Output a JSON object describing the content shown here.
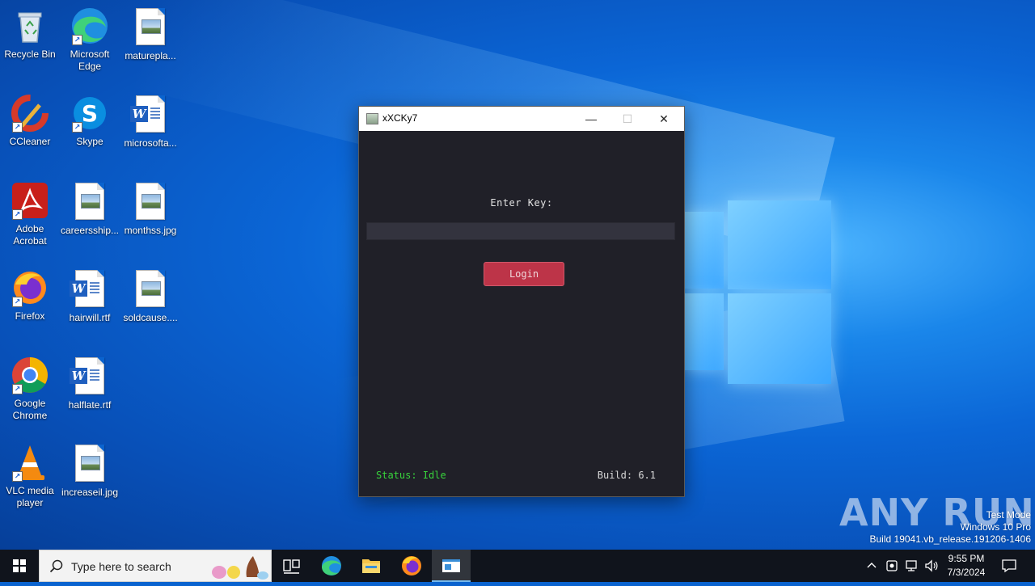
{
  "desktop": {
    "icons": [
      {
        "label": "Recycle Bin"
      },
      {
        "label": "Microsoft Edge"
      },
      {
        "label": "maturepla..."
      },
      {
        "label": "CCleaner"
      },
      {
        "label": "Skype"
      },
      {
        "label": "microsofta..."
      },
      {
        "label": "Adobe Acrobat"
      },
      {
        "label": "careersship..."
      },
      {
        "label": "monthss.jpg"
      },
      {
        "label": "Firefox"
      },
      {
        "label": "hairwill.rtf"
      },
      {
        "label": "soldcause...."
      },
      {
        "label": "Google Chrome"
      },
      {
        "label": "halflate.rtf"
      },
      {
        "label": "VLC media player"
      },
      {
        "label": "increaseil.jpg"
      }
    ]
  },
  "window": {
    "title": "xXCKy7",
    "enter_key_label": "Enter Key:",
    "key_value": "",
    "login_label": "Login",
    "status": "Status: Idle",
    "build": "Build: 6.1",
    "minimize_glyph": "—",
    "maximize_glyph": "☐",
    "close_glyph": "✕"
  },
  "watermark": {
    "brand": "ANY RUN",
    "line1": "Test Mode",
    "line2": "Windows 10 Pro",
    "line3": "Build 19041.vb_release.191206-1406"
  },
  "taskbar": {
    "search_placeholder": "Type here to search",
    "time": "9:55 PM",
    "date": "7/3/2024"
  },
  "colors": {
    "accent_button": "#bd3448",
    "status_green": "#38d43c",
    "window_bg": "#202028"
  }
}
